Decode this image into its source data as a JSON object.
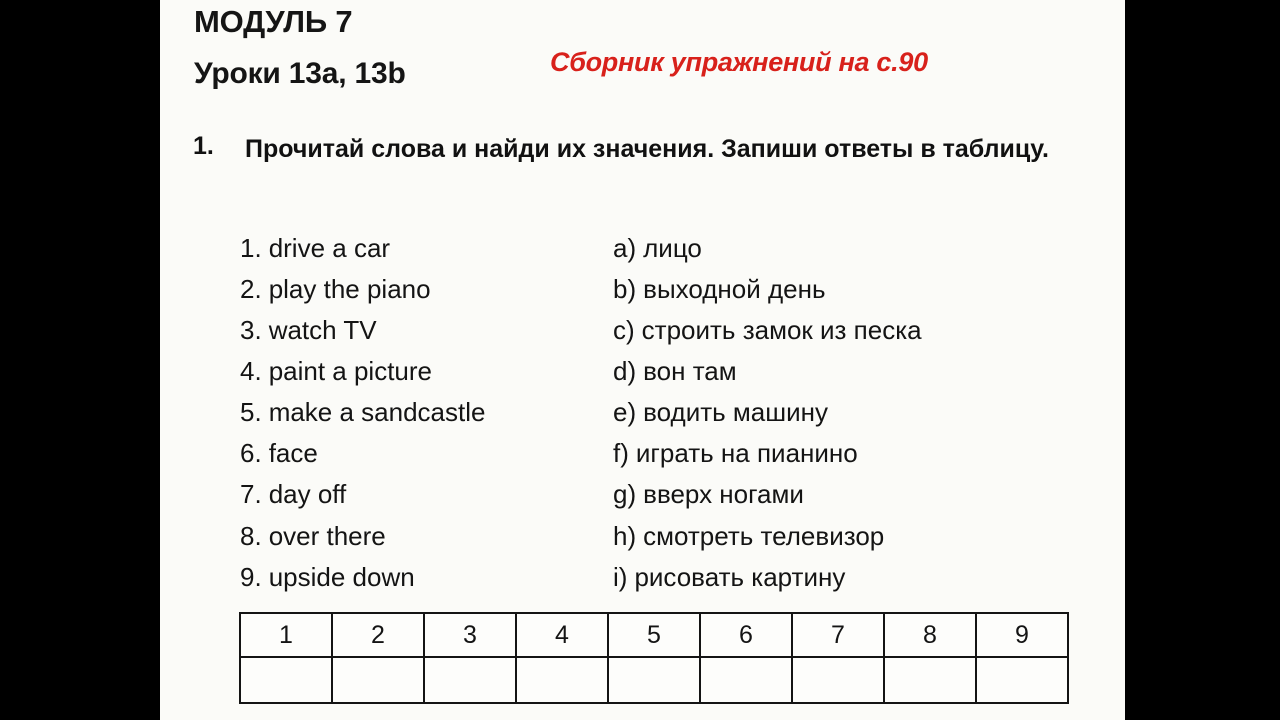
{
  "page": {
    "module_title": "МОДУЛЬ 7",
    "lessons_title": "Уроки 13a, 13b",
    "workbook_note": "Сборник упражнений на с.90",
    "note_color": "#d8211b",
    "background_color": "#fbfbf8",
    "text_color": "#141414"
  },
  "task": {
    "number": "1.",
    "text": "Прочитай слова и найди их значения. Запиши ответы в таблицу."
  },
  "left_column": [
    {
      "marker": "1.",
      "phrase": "drive a car"
    },
    {
      "marker": "2.",
      "phrase": "play the piano"
    },
    {
      "marker": "3.",
      "phrase": "watch TV"
    },
    {
      "marker": "4.",
      "phrase": "paint a picture"
    },
    {
      "marker": "5.",
      "phrase": "make a sandcastle"
    },
    {
      "marker": "6.",
      "phrase": "face"
    },
    {
      "marker": "7.",
      "phrase": "day off"
    },
    {
      "marker": "8.",
      "phrase": "over there"
    },
    {
      "marker": "9.",
      "phrase": "upside down"
    }
  ],
  "right_column": [
    {
      "marker": "a)",
      "phrase": "лицо"
    },
    {
      "marker": "b)",
      "phrase": "выходной день"
    },
    {
      "marker": "c)",
      "phrase": "строить замок из песка"
    },
    {
      "marker": "d)",
      "phrase": "вон там"
    },
    {
      "marker": "e)",
      "phrase": "водить машину"
    },
    {
      "marker": "f)",
      "phrase": "играть на пианино"
    },
    {
      "marker": "g)",
      "phrase": "вверх ногами"
    },
    {
      "marker": "h)",
      "phrase": "смотреть телевизор"
    },
    {
      "marker": "i)",
      "phrase": "рисовать картину"
    }
  ],
  "answer_table": {
    "headers": [
      "1",
      "2",
      "3",
      "4",
      "5",
      "6",
      "7",
      "8",
      "9"
    ],
    "answers": [
      "",
      "",
      "",
      "",
      "",
      "",
      "",
      "",
      ""
    ]
  }
}
